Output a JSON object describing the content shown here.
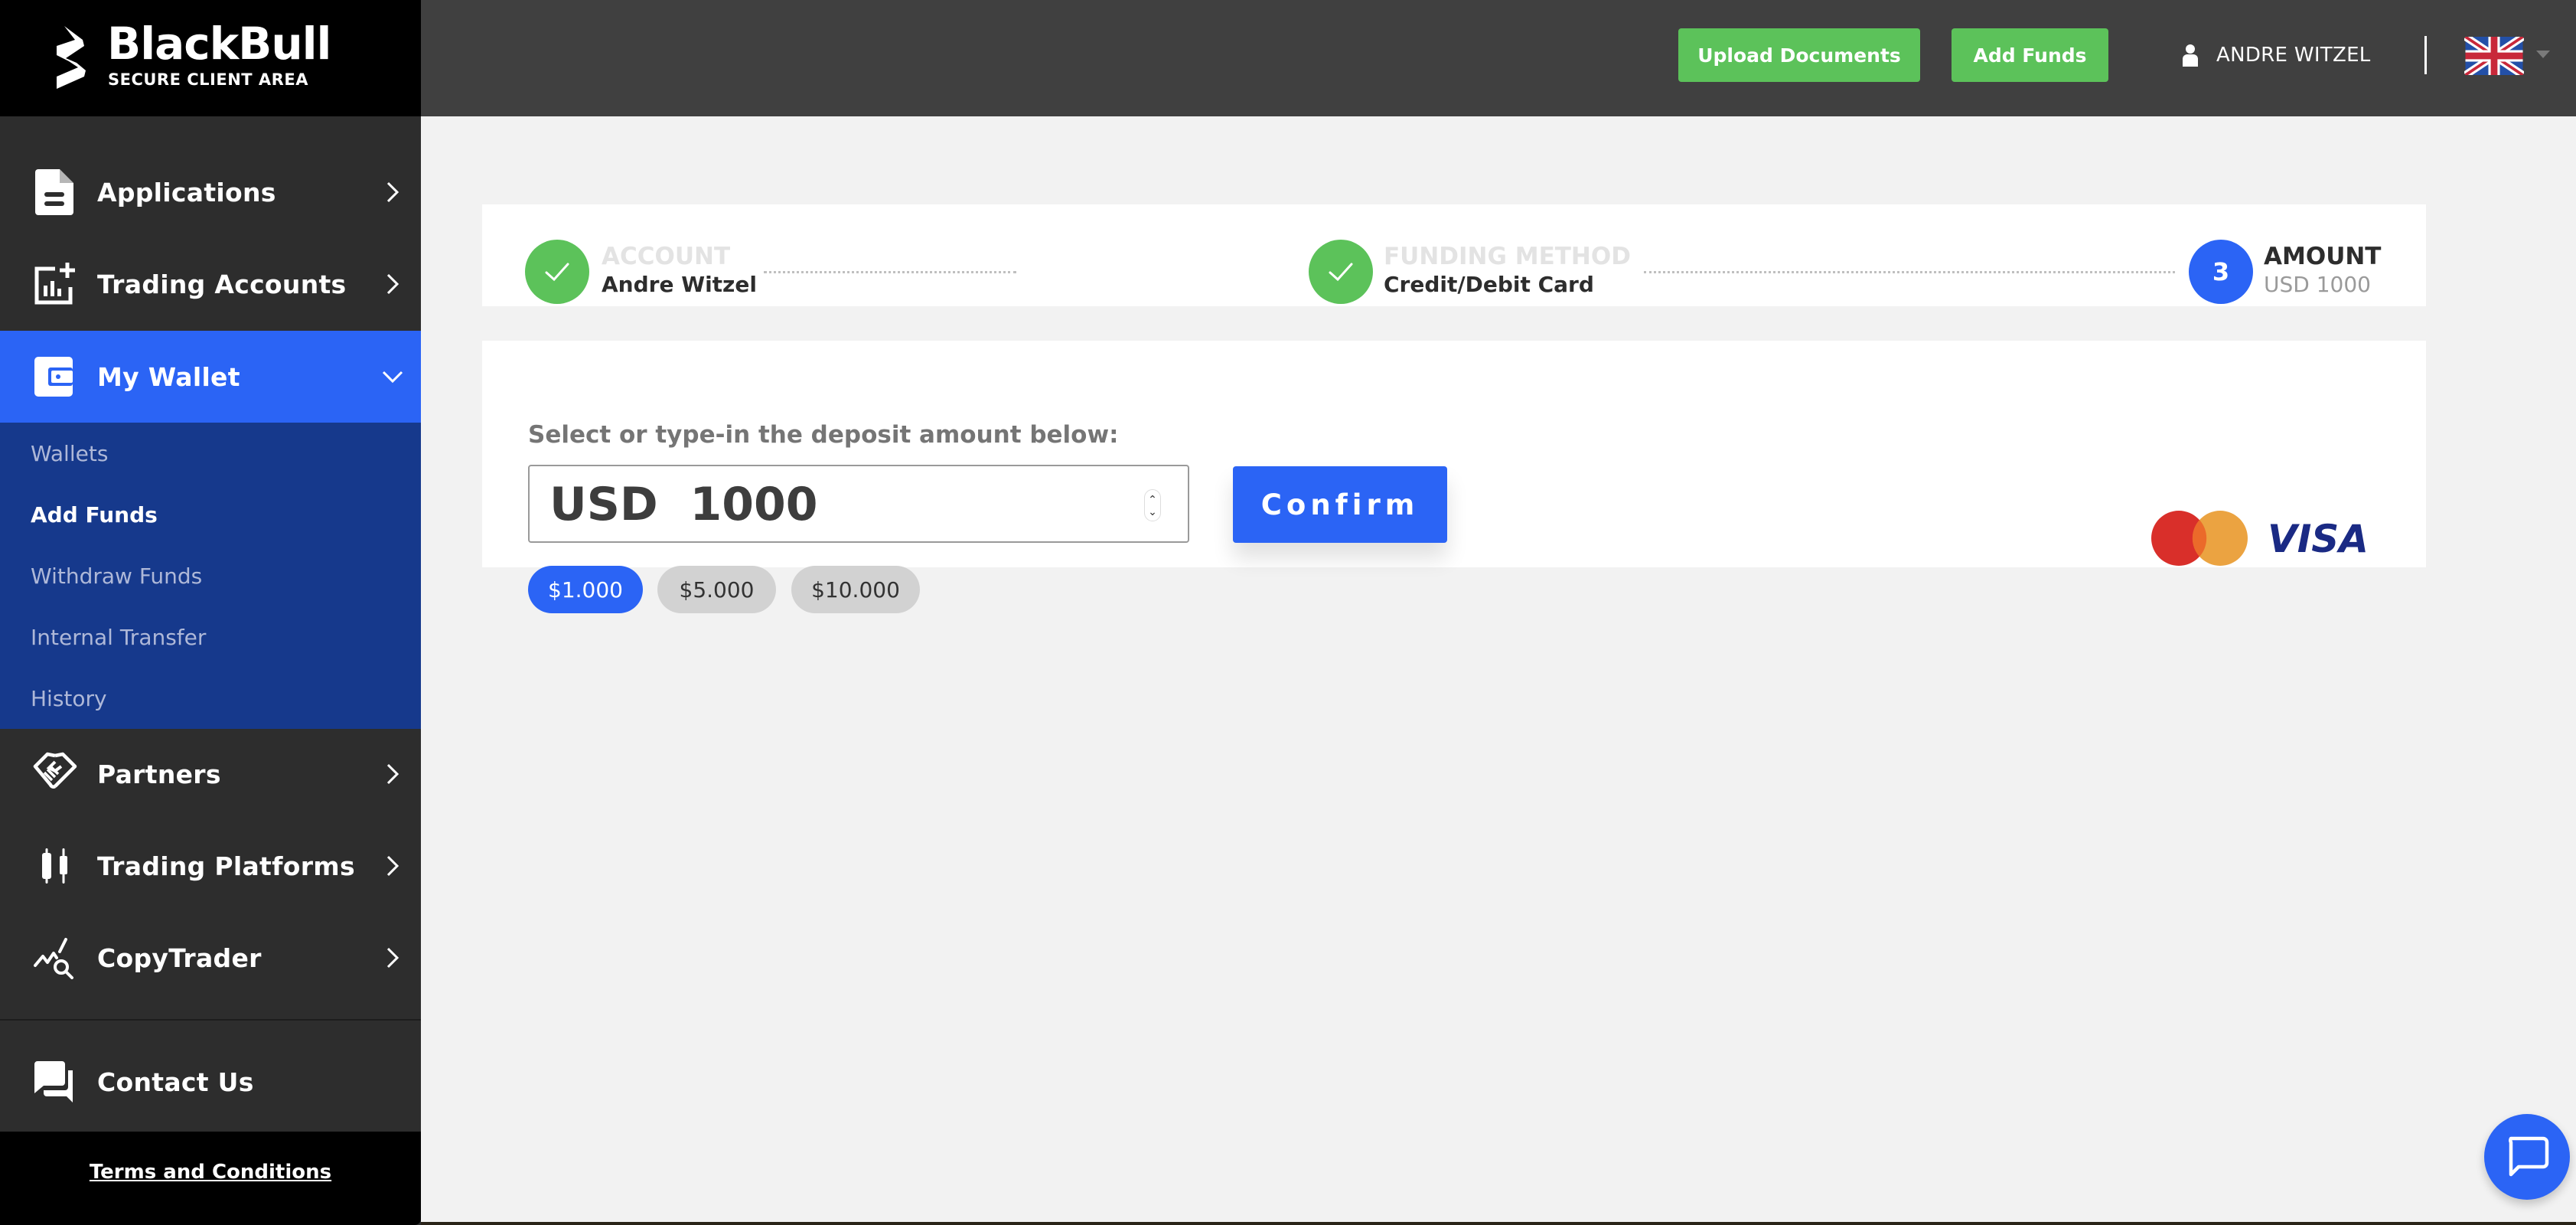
{
  "brand": {
    "name": "BlackBull",
    "subtitle": "SECURE CLIENT AREA"
  },
  "header": {
    "upload_documents_label": "Upload Documents",
    "add_funds_label": "Add Funds",
    "user_name": "ANDRE WITZEL",
    "language_flag": "uk-flag-icon"
  },
  "sidebar": {
    "items": [
      {
        "label": "Applications",
        "icon": "document-icon",
        "expanded": false
      },
      {
        "label": "Trading Accounts",
        "icon": "chart-add-icon",
        "expanded": false
      },
      {
        "label": "My Wallet",
        "icon": "wallet-icon",
        "expanded": true,
        "active": true
      },
      {
        "label": "Partners",
        "icon": "handshake-icon",
        "expanded": false
      },
      {
        "label": "Trading Platforms",
        "icon": "candlestick-icon",
        "expanded": false
      },
      {
        "label": "CopyTrader",
        "icon": "chart-search-icon",
        "expanded": false
      }
    ],
    "wallet_submenu": [
      {
        "label": "Wallets"
      },
      {
        "label": "Add Funds",
        "current": true
      },
      {
        "label": "Withdraw Funds"
      },
      {
        "label": "Internal Transfer"
      },
      {
        "label": "History"
      }
    ],
    "contact": {
      "label": "Contact Us",
      "icon": "chat-icon"
    },
    "terms_label": "Terms and Conditions"
  },
  "stepper": {
    "steps": [
      {
        "title": "ACCOUNT",
        "value": "Andre Witzel",
        "status": "done"
      },
      {
        "title": "FUNDING METHOD",
        "value": "Credit/Debit Card",
        "status": "done"
      },
      {
        "number": "3",
        "title": "AMOUNT",
        "value": "USD 1000",
        "status": "current"
      }
    ]
  },
  "deposit": {
    "instruction": "Select or type-in the deposit amount below:",
    "amount_value": "USD  1000",
    "confirm_label": "Confirm",
    "presets": [
      {
        "label": "$1.000",
        "selected": true
      },
      {
        "label": "$5.000",
        "selected": false
      },
      {
        "label": "$10.000",
        "selected": false
      }
    ],
    "accepted_cards": [
      "mastercard",
      "VISA"
    ]
  },
  "colors": {
    "primary_blue": "#2b64f5",
    "submenu_blue": "#16398c",
    "success_green": "#5cc25a",
    "sidebar_bg": "#2d2d2d",
    "header_bg": "#404040"
  }
}
